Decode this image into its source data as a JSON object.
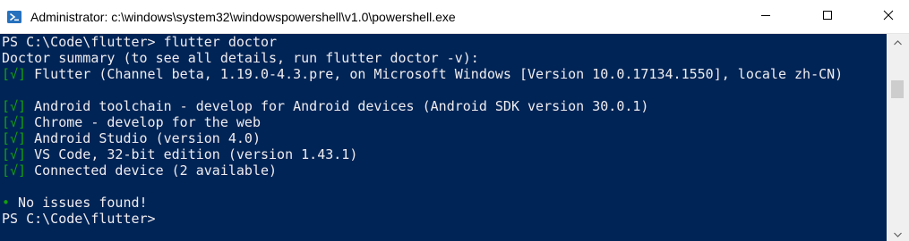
{
  "window": {
    "title": "Administrator: c:\\windows\\system32\\windowspowershell\\v1.0\\powershell.exe",
    "icon": "powershell-icon",
    "controls": [
      "minimize-icon",
      "maximize-icon",
      "close-icon"
    ]
  },
  "console": {
    "lines": [
      {
        "prefix": "",
        "text": "PS C:\\Code\\flutter> flutter doctor"
      },
      {
        "prefix": "",
        "text": "Doctor summary (to see all details, run flutter doctor -v):"
      },
      {
        "prefix": "[√]",
        "text": " Flutter (Channel beta, 1.19.0-4.3.pre, on Microsoft Windows [Version 10.0.17134.1550], locale zh-CN)"
      },
      {
        "prefix": "",
        "text": ""
      },
      {
        "prefix": "[√]",
        "text": " Android toolchain - develop for Android devices (Android SDK version 30.0.1)"
      },
      {
        "prefix": "[√]",
        "text": " Chrome - develop for the web"
      },
      {
        "prefix": "[√]",
        "text": " Android Studio (version 4.0)"
      },
      {
        "prefix": "[√]",
        "text": " VS Code, 32-bit edition (version 1.43.1)"
      },
      {
        "prefix": "[√]",
        "text": " Connected device (2 available)"
      },
      {
        "prefix": "",
        "text": ""
      },
      {
        "prefix": "•",
        "text": " No issues found!"
      },
      {
        "prefix": "",
        "text": "PS C:\\Code\\flutter>"
      }
    ]
  },
  "colors": {
    "console_bg": "#012456",
    "console_fg": "#eeedf0",
    "check_green": "#13a10e",
    "titlebar_bg": "#ffffff"
  }
}
